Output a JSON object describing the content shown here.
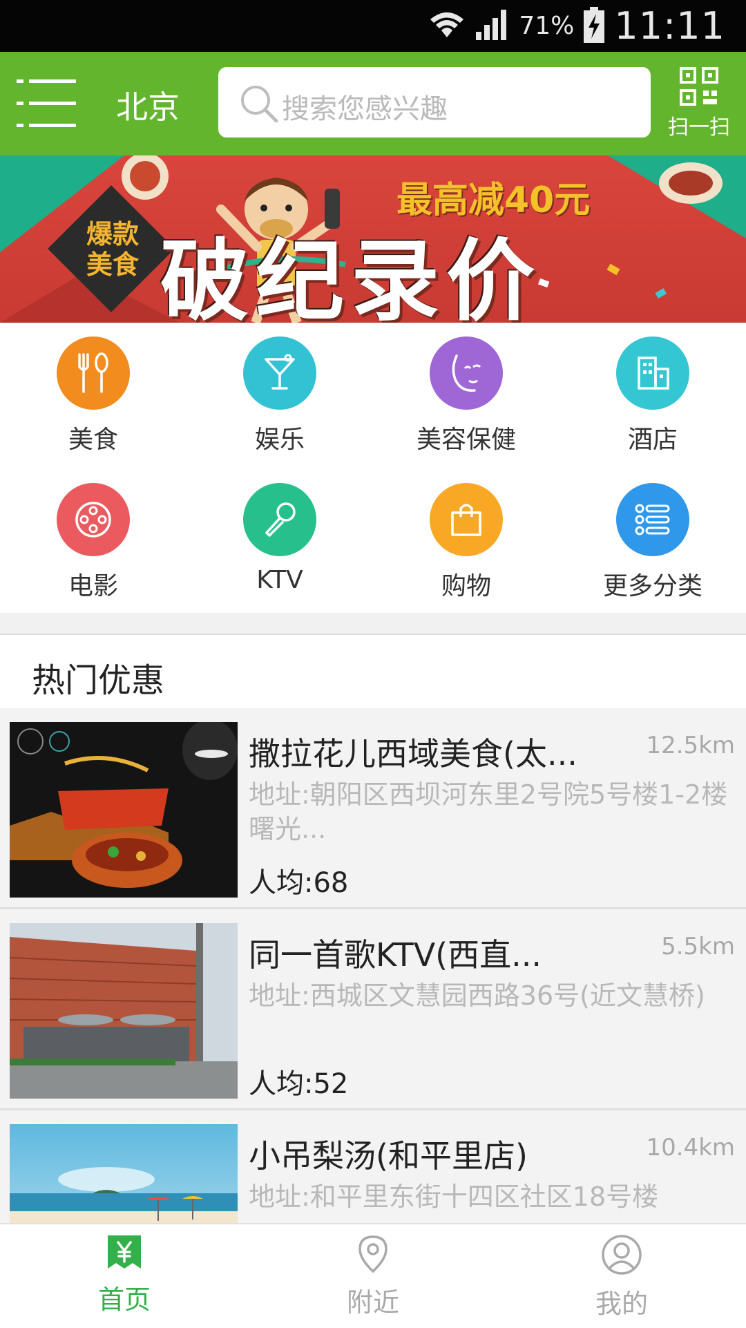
{
  "status_bar": {
    "battery_pct": "71%",
    "time": "11:11",
    "icons": [
      "wifi-icon",
      "signal-icon",
      "battery-charging-icon"
    ]
  },
  "header": {
    "city": "北京",
    "search_placeholder": "搜索您感兴趣",
    "scan_label": "扫一扫",
    "bg_color": "#63b52e"
  },
  "banner": {
    "badge": "爆款美食",
    "headline": "破纪录价",
    "promo": "最高减40元",
    "active_slide": 1,
    "slide_count": 3
  },
  "categories": [
    {
      "label": "美食",
      "icon": "fork-spoon-icon",
      "color": "#f28c1e"
    },
    {
      "label": "娱乐",
      "icon": "cocktail-icon",
      "color": "#33c2d4"
    },
    {
      "label": "美容保健",
      "icon": "face-icon",
      "color": "#9f67d6"
    },
    {
      "label": "酒店",
      "icon": "building-icon",
      "color": "#34c6d2"
    },
    {
      "label": "电影",
      "icon": "film-reel-icon",
      "color": "#ea5a5f"
    },
    {
      "label": "KTV",
      "icon": "microphone-icon",
      "color": "#27c08c"
    },
    {
      "label": "购物",
      "icon": "shopping-bag-icon",
      "color": "#f8a825"
    },
    {
      "label": "更多分类",
      "icon": "list-icon",
      "color": "#2f98ea"
    }
  ],
  "hot": {
    "title": "热门优惠",
    "items": [
      {
        "name": "撒拉花儿西域美食(太...",
        "distance": "12.5km",
        "address": "地址:朝阳区西坝河东里2号院5号楼1-2楼曙光...",
        "avg_price": "人均:68"
      },
      {
        "name": "同一首歌KTV(西直...",
        "distance": "5.5km",
        "address": "地址:西城区文慧园西路36号(近文慧桥)",
        "avg_price": "人均:52"
      },
      {
        "name": "小吊梨汤(和平里店)",
        "distance": "10.4km",
        "address": "地址:和平里东街十四区社区18号楼",
        "avg_price": ""
      }
    ]
  },
  "bottom_nav": [
    {
      "label": "首页",
      "icon": "home-yen-icon",
      "active": true
    },
    {
      "label": "附近",
      "icon": "location-pin-icon",
      "active": false
    },
    {
      "label": "我的",
      "icon": "user-icon",
      "active": false
    }
  ],
  "colors": {
    "accent": "#63b52e",
    "active_tab": "#33b04a",
    "inactive_tab": "#a9a9a9"
  }
}
